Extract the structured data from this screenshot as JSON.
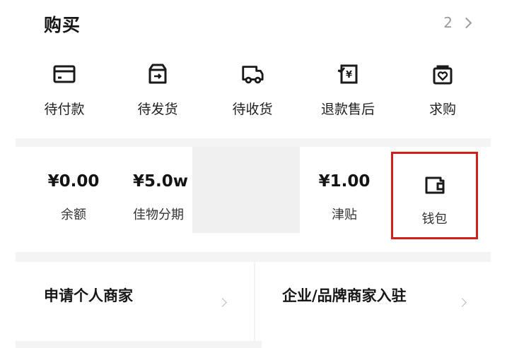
{
  "purchase": {
    "title": "购买",
    "count": "2",
    "orders": [
      {
        "label": "待付款",
        "icon": "card-icon"
      },
      {
        "label": "待发货",
        "icon": "box-icon"
      },
      {
        "label": "待收货",
        "icon": "truck-icon"
      },
      {
        "label": "退款售后",
        "icon": "refund-icon"
      },
      {
        "label": "求购",
        "icon": "wanted-bag-icon"
      }
    ]
  },
  "assets": [
    {
      "value": "¥0.00",
      "label": "余额"
    },
    {
      "value": "¥5.0w",
      "label": "佳物分期"
    },
    {
      "value": "¥1.00",
      "label": "津贴"
    }
  ],
  "wallet": {
    "label": "钱包",
    "icon": "wallet-icon",
    "highlight_color": "#d0201c"
  },
  "merchants": {
    "personal": "申请个人商家",
    "enterprise": "企业/品牌商家入驻"
  }
}
